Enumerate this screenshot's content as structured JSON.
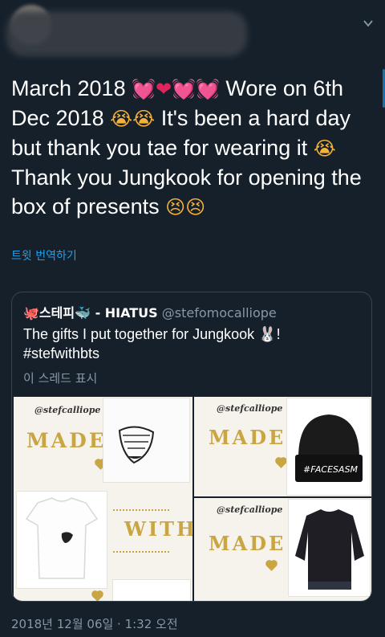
{
  "tweet": {
    "segments": [
      {
        "kind": "text",
        "value": "March 2018 "
      },
      {
        "kind": "emoji",
        "value": "💓",
        "style": "pink"
      },
      {
        "kind": "emoji",
        "value": "❤",
        "style": "red"
      },
      {
        "kind": "emoji",
        "value": "💓",
        "style": "pink"
      },
      {
        "kind": "emoji",
        "value": "💓",
        "style": "pink"
      },
      {
        "kind": "text",
        "value": " Wore on 6th Dec 2018 "
      },
      {
        "kind": "emoji",
        "value": "😭",
        "style": "face"
      },
      {
        "kind": "emoji",
        "value": "😭",
        "style": "face"
      },
      {
        "kind": "text",
        "value": " It's been a hard day but thank you tae for wearing it "
      },
      {
        "kind": "emoji",
        "value": "😭",
        "style": "face"
      },
      {
        "kind": "text",
        "value": " Thank you Jungkook for opening the box of presents "
      },
      {
        "kind": "emoji",
        "value": "😣",
        "style": "face"
      },
      {
        "kind": "emoji",
        "value": "😣",
        "style": "face"
      }
    ],
    "translate_label": "트윗 번역하기",
    "timestamp": "2018년 12월 06일 · 1:32 오전"
  },
  "quoted": {
    "display_name": "🐙스테피🐳 - HIATUS",
    "handle": "@stefomocalliope",
    "body_line1": "The gifts I put together for Jungkook 🐰!",
    "body_line2": "#stefwithbts",
    "show_thread": "이 스레드 표시"
  },
  "collage": {
    "watermark": "@stefcalliope",
    "word_made": "MADE",
    "word_with": "WITH",
    "beanie_text": "#FACESASM"
  },
  "icons": {
    "caret": "chevron-down-icon"
  }
}
